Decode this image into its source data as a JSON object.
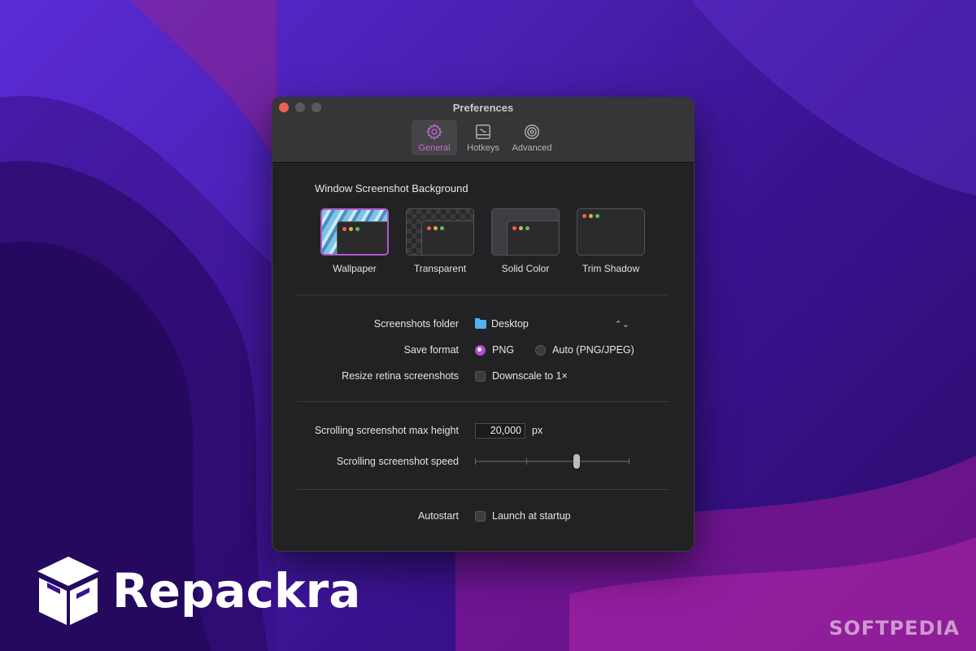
{
  "window": {
    "title": "Preferences",
    "toolbar": [
      {
        "label": "General",
        "icon": "gear-icon",
        "active": true
      },
      {
        "label": "Hotkeys",
        "icon": "keyboard-icon",
        "active": false
      },
      {
        "label": "Advanced",
        "icon": "spiral-icon",
        "active": false
      }
    ]
  },
  "background_section": {
    "title": "Window Screenshot Background",
    "options": [
      {
        "label": "Wallpaper",
        "selected": true
      },
      {
        "label": "Transparent",
        "selected": false
      },
      {
        "label": "Solid Color",
        "selected": false
      },
      {
        "label": "Trim Shadow",
        "selected": false
      }
    ]
  },
  "settings": {
    "folder": {
      "label": "Screenshots folder",
      "value": "Desktop",
      "arrows": "⌃⌄"
    },
    "format": {
      "label": "Save format",
      "options": [
        "PNG",
        "Auto (PNG/JPEG)"
      ],
      "selected": "PNG"
    },
    "resize": {
      "label": "Resize retina screenshots",
      "checkbox_label": "Downscale to 1×",
      "checked": false
    },
    "max_height": {
      "label": "Scrolling screenshot max height",
      "value": "20,000",
      "unit": "px"
    },
    "speed": {
      "label": "Scrolling screenshot speed",
      "ticks": 4,
      "value_fraction": 0.66
    },
    "autostart": {
      "label": "Autostart",
      "checkbox_label": "Launch at startup",
      "checked": false
    }
  },
  "branding": {
    "logo_text": "Repackra",
    "watermark": "SOFTPEDIA"
  },
  "colors": {
    "accent": "#b34ad0",
    "window_bg": "#222224",
    "titlebar_bg": "#363638"
  }
}
